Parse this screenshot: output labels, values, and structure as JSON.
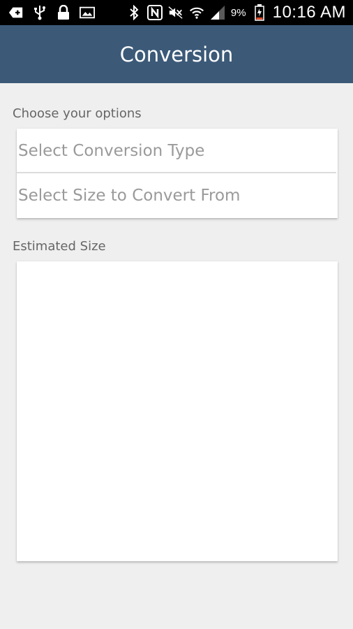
{
  "status_bar": {
    "battery_percent": "9%",
    "time": "10:16 AM",
    "left_icons": [
      "add-message-icon",
      "usb-icon",
      "lock-icon",
      "image-icon"
    ],
    "right_icons": [
      "bluetooth-icon",
      "nfc-icon",
      "mute-icon",
      "wifi-icon",
      "signal-icon",
      "battery-icon"
    ]
  },
  "app_bar": {
    "title": "Conversion",
    "background_color": "#3c5a78"
  },
  "options_section": {
    "label": "Choose your options",
    "conversion_type_placeholder": "Select Conversion Type",
    "size_from_placeholder": "Select Size to Convert From"
  },
  "result_section": {
    "label": "Estimated Size",
    "value": ""
  }
}
